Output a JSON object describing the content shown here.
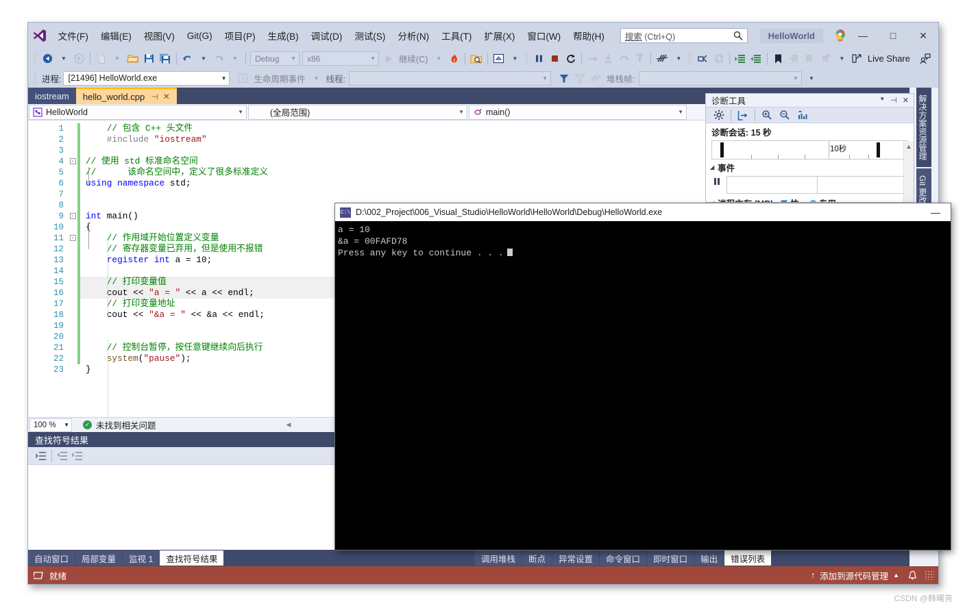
{
  "window": {
    "menu": [
      {
        "label": "文件(F)"
      },
      {
        "label": "编辑(E)"
      },
      {
        "label": "视图(V)"
      },
      {
        "label": "Git(G)"
      },
      {
        "label": "项目(P)"
      },
      {
        "label": "生成(B)"
      },
      {
        "label": "调试(D)"
      },
      {
        "label": "测试(S)"
      },
      {
        "label": "分析(N)"
      },
      {
        "label": "工具(T)"
      },
      {
        "label": "扩展(X)"
      },
      {
        "label": "窗口(W)"
      },
      {
        "label": "帮助(H)"
      }
    ],
    "search_placeholder_main": "搜索",
    "search_placeholder_hint": " (Ctrl+Q)",
    "project_chip": "HelloWorld",
    "controls": {
      "minimize": "—",
      "maximize": "□",
      "close": "✕"
    }
  },
  "toolbar": {
    "config": "Debug",
    "platform": "x86",
    "continue_label": "继续(C)",
    "live_share": "Live Share"
  },
  "debugbar": {
    "process_label": "进程:",
    "process_value": "[21496] HelloWorld.exe",
    "lifecycle_label": "生命周期事件",
    "thread_label": "线程:",
    "thread_value": "",
    "stackframe_label": "堆栈帧:",
    "stackframe_value": ""
  },
  "doc_tabs": [
    {
      "label": "iostream",
      "active": false
    },
    {
      "label": "hello_world.cpp",
      "active": true
    }
  ],
  "navbar": {
    "project": "HelloWorld",
    "scope": "(全局范围)",
    "member": "main()"
  },
  "code": {
    "lines": [
      {
        "n": 1,
        "fold": "",
        "text": "    // 包含 C++ 头文件"
      },
      {
        "n": 2,
        "fold": "",
        "text": "    #include \"iostream\""
      },
      {
        "n": 3,
        "fold": "",
        "text": ""
      },
      {
        "n": 4,
        "fold": "-",
        "text": "// 使用 std 标准命名空间"
      },
      {
        "n": 5,
        "fold": "",
        "text": "//      该命名空间中，定义了很多标准定义"
      },
      {
        "n": 6,
        "fold": "",
        "text": "using namespace std;"
      },
      {
        "n": 7,
        "fold": "",
        "text": ""
      },
      {
        "n": 8,
        "fold": "",
        "text": ""
      },
      {
        "n": 9,
        "fold": "-",
        "text": "int main()"
      },
      {
        "n": 10,
        "fold": "",
        "text": "{"
      },
      {
        "n": 11,
        "fold": "-",
        "text": "    // 作用域开始位置定义变量"
      },
      {
        "n": 12,
        "fold": "",
        "text": "    // 寄存器变量已弃用，但是使用不报错"
      },
      {
        "n": 13,
        "fold": "",
        "text": "    register int a = 10;"
      },
      {
        "n": 14,
        "fold": "",
        "text": ""
      },
      {
        "n": 15,
        "fold": "",
        "text": "    // 打印变量值"
      },
      {
        "n": 16,
        "fold": "",
        "text": "    cout << \"a = \" << a << endl;"
      },
      {
        "n": 17,
        "fold": "",
        "text": "    // 打印变量地址"
      },
      {
        "n": 18,
        "fold": "",
        "text": "    cout << \"&a = \" << &a << endl;"
      },
      {
        "n": 19,
        "fold": "",
        "text": ""
      },
      {
        "n": 20,
        "fold": "",
        "text": ""
      },
      {
        "n": 21,
        "fold": "",
        "text": "    // 控制台暂停，按任意键继续向后执行"
      },
      {
        "n": 22,
        "fold": "",
        "text": "    system(\"pause\");"
      },
      {
        "n": 23,
        "fold": "",
        "text": "}"
      }
    ]
  },
  "editor_status": {
    "zoom": "100 %",
    "issues": "未找到相关问题"
  },
  "find_panel": {
    "title": "查找符号结果"
  },
  "bottom_tabs_left": [
    {
      "label": "自动窗口",
      "active": false
    },
    {
      "label": "局部变量",
      "active": false
    },
    {
      "label": "监视 1",
      "active": false
    },
    {
      "label": "查找符号结果",
      "active": true
    }
  ],
  "bottom_tabs_right": [
    {
      "label": "调用堆栈",
      "active": false
    },
    {
      "label": "断点",
      "active": false
    },
    {
      "label": "异常设置",
      "active": false
    },
    {
      "label": "命令窗口",
      "active": false
    },
    {
      "label": "即时窗口",
      "active": false
    },
    {
      "label": "输出",
      "active": false
    },
    {
      "label": "错误列表",
      "active": true
    }
  ],
  "right_vtabs": [
    {
      "label": "解决方案资源管理器"
    },
    {
      "label": "Git 更改"
    }
  ],
  "diagnostics": {
    "title": "诊断工具",
    "session_label": "诊断会话: 15 秒",
    "ruler_label": "10秒",
    "events_label": "事件",
    "memory_label": "进程内存 (MB)",
    "legend_snapshot": "快..",
    "legend_private": "专用...",
    "legend_snapshot_color": "#2b7fd4",
    "legend_private_color": "#63b0e8"
  },
  "console": {
    "title": "D:\\002_Project\\006_Visual_Studio\\HelloWorld\\HelloWorld\\Debug\\HelloWorld.exe",
    "lines": [
      "a = 10",
      "&a = 00FAFD78",
      "Press any key to continue . . ."
    ],
    "minimize": "—"
  },
  "statusbar": {
    "state": "就绪",
    "source_control": "添加到源代码管理",
    "bg_color": "#a0483c"
  },
  "watermark": "CSDN @韩曙亮"
}
